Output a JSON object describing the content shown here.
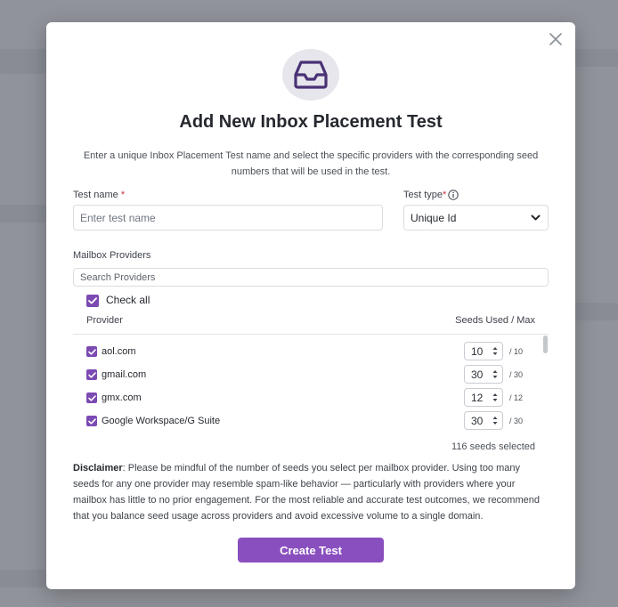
{
  "modal": {
    "title": "Add New Inbox Placement Test",
    "subtitle": "Enter a unique Inbox Placement Test name and select the specific providers with the corresponding seed numbers that will be used in the test.",
    "icon": "inbox-tray-icon"
  },
  "form": {
    "test_name_label": "Test name",
    "test_name_required": "*",
    "test_name_placeholder": "Enter test name",
    "test_type_label": "Test type",
    "test_type_required": "*",
    "test_type_value": "Unique Id"
  },
  "providers": {
    "section_label": "Mailbox Providers",
    "search_placeholder": "Search Providers",
    "check_all_label": "Check all",
    "col_provider": "Provider",
    "col_seeds": "Seeds Used / Max",
    "rows": [
      {
        "name": "aol.com",
        "used": "10",
        "max": "/ 10",
        "checked": true
      },
      {
        "name": "gmail.com",
        "used": "30",
        "max": "/ 30",
        "checked": true
      },
      {
        "name": "gmx.com",
        "used": "12",
        "max": "/ 12",
        "checked": true
      },
      {
        "name": "Google Workspace/G Suite",
        "used": "30",
        "max": "/ 30",
        "checked": true
      }
    ],
    "seeds_selected": "116 seeds selected"
  },
  "disclaimer": {
    "heading": "Disclaimer",
    "text": ": Please be mindful of the number of seeds you select per mailbox provider. Using too many seeds for any one provider may resemble spam-like behavior — particularly with providers where your mailbox has little to no prior engagement. For the most reliable and accurate test outcomes, we recommend that you balance seed usage across providers and avoid excessive volume to a single domain."
  },
  "actions": {
    "create_label": "Create Test"
  },
  "colors": {
    "accent": "#8a4fbf",
    "checkbox": "#7c4ab3"
  }
}
